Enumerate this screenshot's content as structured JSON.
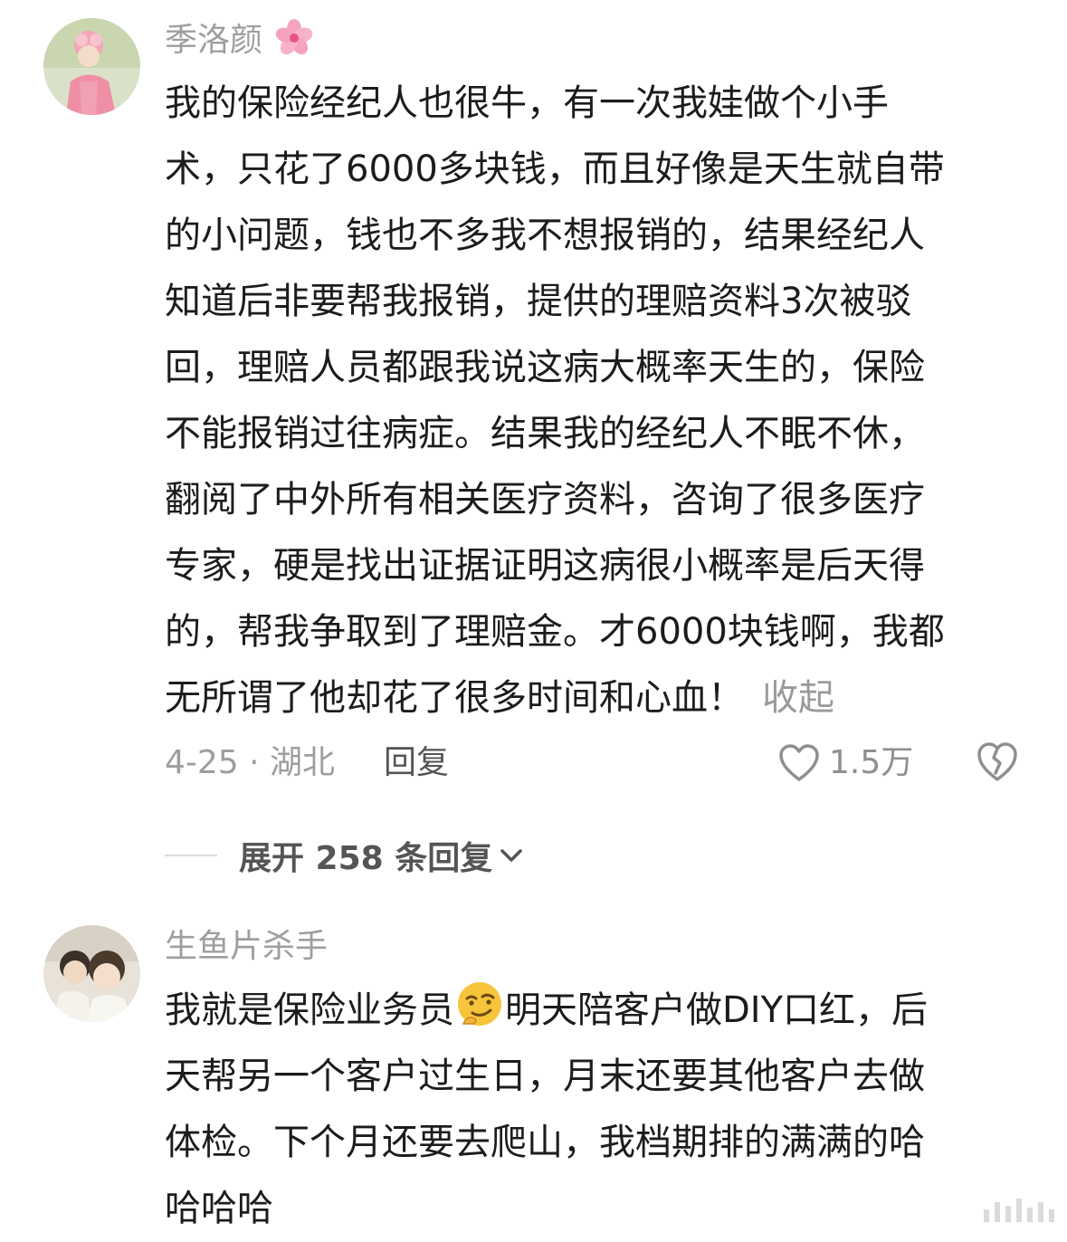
{
  "comments": [
    {
      "username": "季洛颜",
      "username_emoji": "cherry-blossom",
      "lines": [
        "我的保险经纪人也很牛，有一次我娃做个小手",
        "术，只花了6000多块钱，而且好像是天生就自带",
        "的小问题，钱也不多我不想报销的，结果经纪人",
        "知道后非要帮我报销，提供的理赔资料3次被驳",
        "回，理赔人员都跟我说这病大概率天生的，保险",
        "不能报销过往病症。结果我的经纪人不眠不休，",
        "翻阅了中外所有相关医疗资料，咨询了很多医疗",
        "专家，硬是找出证据证明这病很小概率是后天得",
        "的，帮我争取到了理赔金。才6000块钱啊，我都",
        "无所谓了他却花了很多时间和心血！"
      ],
      "collapse_label": "收起",
      "date_location": "4-25 · 湖北",
      "reply_label": "回复",
      "like_count": "1.5万",
      "like_icon": "heart-outline",
      "dislike_icon": "broken-heart-outline"
    },
    {
      "username": "生鱼片杀手",
      "lines_part1": "我就是保险业务员",
      "inline_emoji": "smirk-face",
      "lines_part2": "明天陪客户做DIY口红，后",
      "lines": [
        "天帮另一个客户过生日，月末还要其他客户去做",
        "体检。下个月还要去爬山，我档期排的满满的哈",
        "哈哈哈"
      ]
    }
  ],
  "expand_replies": {
    "label": "展开 258 条回复",
    "icon": "chevron-down"
  },
  "colors": {
    "text": "#1c1c1c",
    "muted": "#9e9e9e",
    "secondary": "#555555",
    "background": "#ffffff"
  }
}
